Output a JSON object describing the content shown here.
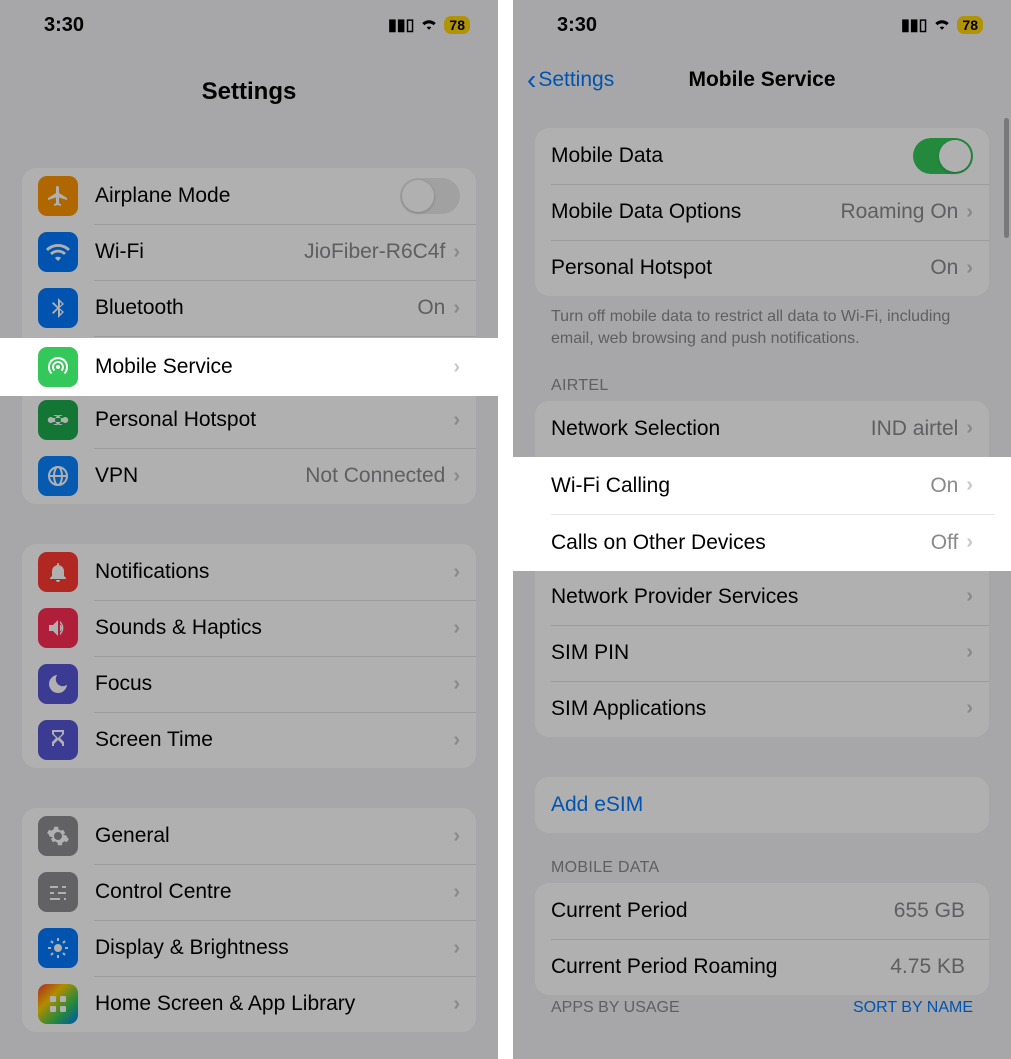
{
  "status": {
    "time": "3:30",
    "battery": "78"
  },
  "left": {
    "title": "Settings",
    "group1": {
      "airplane": {
        "label": "Airplane Mode",
        "on": false
      },
      "wifi": {
        "label": "Wi-Fi",
        "value": "JioFiber-R6C4f"
      },
      "bluetooth": {
        "label": "Bluetooth",
        "value": "On"
      },
      "mobile": {
        "label": "Mobile Service"
      },
      "hotspot": {
        "label": "Personal Hotspot"
      },
      "vpn": {
        "label": "VPN",
        "value": "Not Connected"
      }
    },
    "group2": {
      "notifications": {
        "label": "Notifications"
      },
      "sounds": {
        "label": "Sounds & Haptics"
      },
      "focus": {
        "label": "Focus"
      },
      "screentime": {
        "label": "Screen Time"
      }
    },
    "group3": {
      "general": {
        "label": "General"
      },
      "control": {
        "label": "Control Centre"
      },
      "display": {
        "label": "Display & Brightness"
      },
      "home": {
        "label": "Home Screen & App Library"
      }
    }
  },
  "right": {
    "back": "Settings",
    "title": "Mobile Service",
    "group1": {
      "data": {
        "label": "Mobile Data",
        "on": true
      },
      "options": {
        "label": "Mobile Data Options",
        "value": "Roaming On"
      },
      "hotspot": {
        "label": "Personal Hotspot",
        "value": "On"
      }
    },
    "footer1": "Turn off mobile data to restrict all data to Wi-Fi, including email, web browsing and push notifications.",
    "carrier_header": "AIRTEL",
    "group2": {
      "network": {
        "label": "Network Selection",
        "value": "IND airtel"
      },
      "wificalling": {
        "label": "Wi-Fi Calling",
        "value": "On"
      },
      "callsother": {
        "label": "Calls on Other Devices",
        "value": "Off"
      },
      "provider": {
        "label": "Network Provider Services"
      },
      "simpin": {
        "label": "SIM PIN"
      },
      "simapps": {
        "label": "SIM Applications"
      }
    },
    "group3": {
      "addesim": {
        "label": "Add eSIM"
      }
    },
    "mobiledata_header": "MOBILE DATA",
    "group4": {
      "period": {
        "label": "Current Period",
        "value": "655 GB"
      },
      "roaming": {
        "label": "Current Period Roaming",
        "value": "4.75 KB"
      }
    },
    "apps_header": "APPS BY USAGE",
    "sort": "SORT BY NAME"
  }
}
